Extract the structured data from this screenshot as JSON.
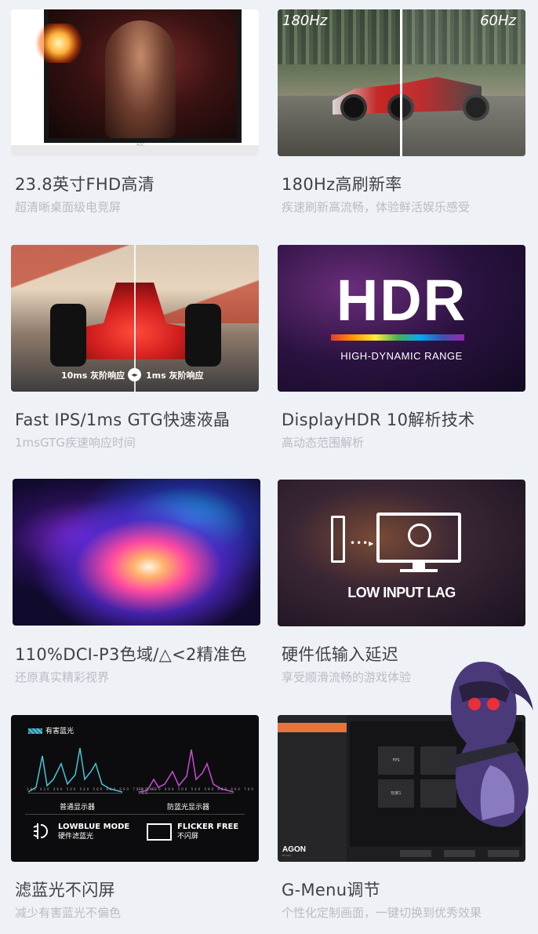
{
  "cards": [
    {
      "title": "23.8英寸FHD高清",
      "subtitle": "超清晰桌面级电竞屏",
      "image_text": {
        "logo": "AOC"
      }
    },
    {
      "title": "180Hz高刷新率",
      "subtitle": "疾速刷新高流畅，体验鲜活娱乐感受",
      "image_text": {
        "left": "180Hz",
        "right": "60Hz"
      }
    },
    {
      "title": "Fast IPS/1ms GTG快速液晶",
      "subtitle": "1msGTG疾速响应时间",
      "image_text": {
        "left": "10ms 灰阶响应",
        "right": "1ms 灰阶响应",
        "knob": "◂▸"
      }
    },
    {
      "title": "DisplayHDR 10解析技术",
      "subtitle": "高动态范围解析",
      "image_text": {
        "big": "HDR",
        "small": "HIGH-DYNAMIC RANGE"
      }
    },
    {
      "title": "110%DCI-P3色域/△<2精准色",
      "subtitle": "还原真实精彩视界"
    },
    {
      "title": "硬件低输入延迟",
      "subtitle": "享受顺滑流畅的游戏体验",
      "image_text": {
        "dots": "•••▸",
        "caption": "LOW INPUT LAG"
      }
    },
    {
      "title": "滤蓝光不闪屏",
      "subtitle": "减少有害蓝光不偏色",
      "image_text": {
        "legend": "有害蓝光",
        "ticks": "380 420 460 500 540 580 620 660 700 740",
        "chart_left": "普通显示器",
        "chart_right": "防蓝光显示器",
        "feat1_title": "LOWBLUE MODE",
        "feat1_sub": "硬件滤蓝光",
        "feat2_title": "FLICKER FREE",
        "feat2_sub": "不闪屏"
      }
    },
    {
      "title": "G-Menu调节",
      "subtitle": "个性化定制画面，一键切换到优秀效果",
      "image_text": {
        "brand": "AGON",
        "brand_sub": "BY AOC",
        "tile1": "FPS",
        "tile2": "玩家1"
      }
    }
  ],
  "colors": {
    "background": "#eef1f6",
    "title": "#3e4147",
    "subtitle": "#b9bdc4",
    "accent": "#e8743b"
  }
}
